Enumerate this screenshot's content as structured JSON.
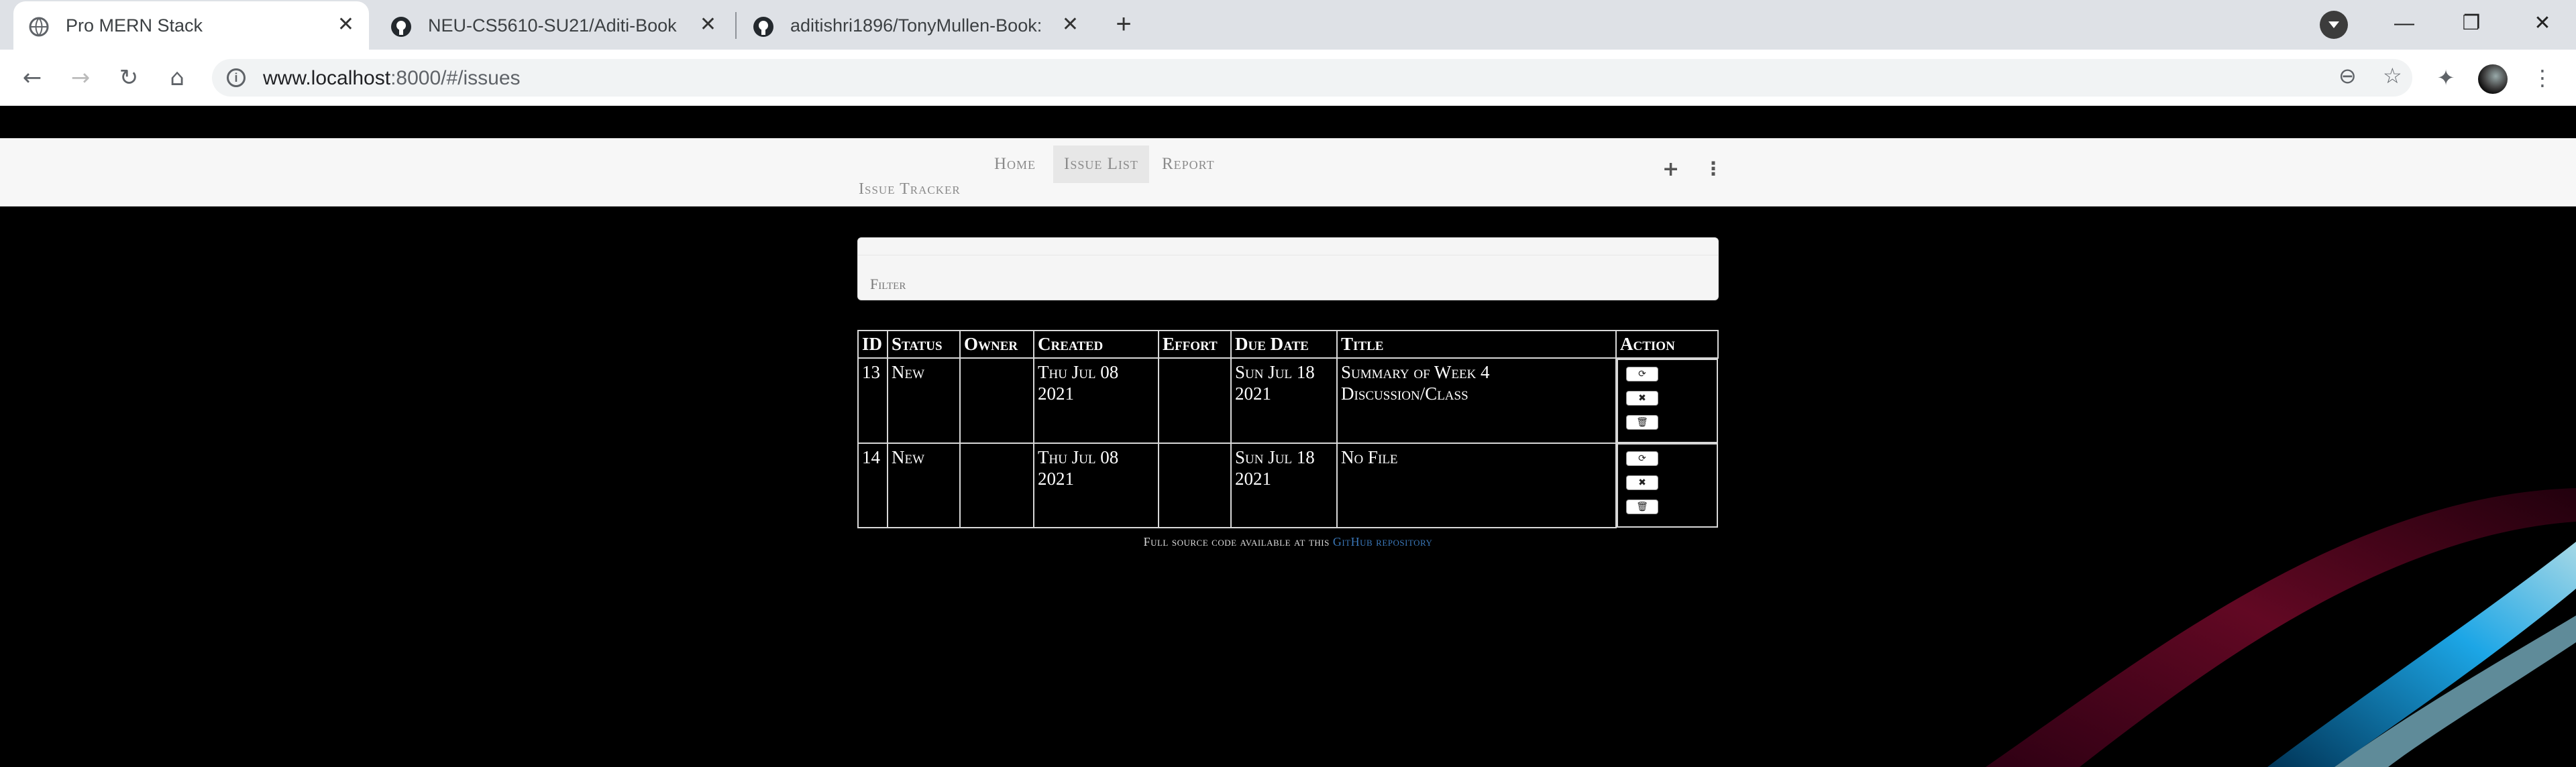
{
  "browser": {
    "tabs": [
      {
        "title": "Pro MERN Stack",
        "active": true,
        "favicon": "globe-icon"
      },
      {
        "title": "NEU-CS5610-SU21/Aditi-Book",
        "active": false,
        "favicon": "github-icon"
      },
      {
        "title": "aditishri1896/TonyMullen-Book: V",
        "active": false,
        "favicon": "github-icon"
      }
    ],
    "new_tab": "+",
    "url_host": "www.localhost",
    "url_path": ":8000/#/issues"
  },
  "app": {
    "brand": "Issue Tracker",
    "nav": [
      {
        "label": "Home",
        "active": false
      },
      {
        "label": "Issue List",
        "active": true
      },
      {
        "label": "Report",
        "active": false
      }
    ],
    "add_glyph": "+",
    "more_glyph": "⋮",
    "filter_label": "Filter",
    "table": {
      "headers": [
        "ID",
        "Status",
        "Owner",
        "Created",
        "Effort",
        "Due Date",
        "Title",
        "Action"
      ],
      "rows": [
        {
          "id": "13",
          "status": "New",
          "owner": "",
          "created": "Thu Jul 08 2021",
          "effort": "",
          "due": "Sun Jul 18 2021",
          "title": "Summary of Week 4 Discussion/Class"
        },
        {
          "id": "14",
          "status": "New",
          "owner": "",
          "created": "Thu Jul 08 2021",
          "effort": "",
          "due": "Sun Jul 18 2021",
          "title": "No File"
        }
      ]
    },
    "footer_text": "Full source code available at this ",
    "footer_link": "GitHub repository"
  }
}
